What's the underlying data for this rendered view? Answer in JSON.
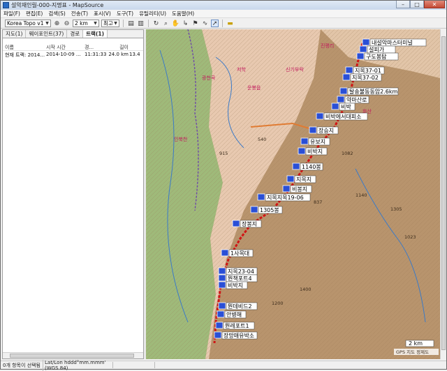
{
  "window": {
    "title": "설악재인릴-000-지명표 - MapSource",
    "minimize": "–",
    "maximize": "□",
    "close": "✕"
  },
  "menu": [
    "파일(F)",
    "편집(E)",
    "검색(S)",
    "전송(T)",
    "표시(V)",
    "도구(T)",
    "유틸리티(U)",
    "도움말(H)"
  ],
  "toolbar": {
    "map_product": "Korea Topo v1",
    "scale": "2 km",
    "detail": "최고"
  },
  "tabs": [
    "지도(1)",
    "웨이포인트(37)",
    "경로",
    "트랙(1)"
  ],
  "track_table": {
    "headers": [
      "이름",
      "시작 시간",
      "경...",
      "길이",
      ""
    ],
    "rows": [
      [
        "현재 트랙: 2014...",
        "2014-10-09 ...",
        "11:31:33",
        "24.0 km",
        "13.4 s"
      ]
    ]
  },
  "map": {
    "waypoints": [
      "내설악마스터미널",
      "설피가",
      "구도봉탐",
      "지목37-01",
      "지목37-02",
      "탈송불동동암2.6km",
      "약마산로",
      "비박",
      "비박에서대피소",
      "장승지",
      "유보지",
      "비박지",
      "1140봉",
      "지목지",
      "비봉지",
      "지목지목19-06",
      "1305봉",
      "장봉지",
      "1사목대",
      "지목23-04",
      "뭔책포트4",
      "비박지",
      "뭔데비드2",
      "안병해",
      "뭔레포트1",
      "장망매유박소"
    ],
    "places": [
      "광천곡",
      "운봉읍",
      "진평리",
      "신기부락",
      "저학",
      "화산",
      "인북천"
    ],
    "peaks": [
      "1082",
      "915",
      "540",
      "837",
      "1140",
      "1023",
      "1305",
      "1200",
      "1400"
    ],
    "scale_label": "2 km",
    "attribution": "GPS 지도 정제도"
  },
  "status": {
    "selection": "0개 항목이 선택됨",
    "coords": "Lat/Lon hddd°mm.mmm' (WGS 84)"
  }
}
